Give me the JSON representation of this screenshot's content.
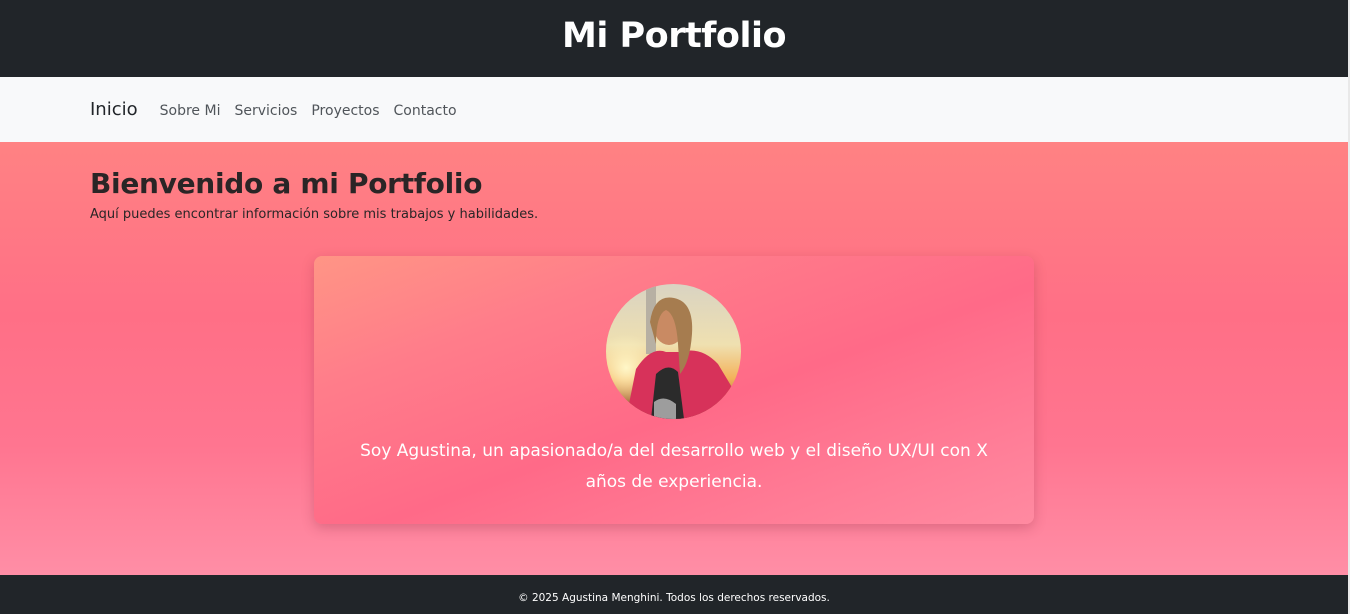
{
  "header": {
    "title": "Mi Portfolio"
  },
  "navbar": {
    "brand": "Inicio",
    "links": [
      "Sobre Mi",
      "Servicios",
      "Proyectos",
      "Contacto"
    ]
  },
  "hero": {
    "title": "Bienvenido a mi Portfolio",
    "subtitle": "Aquí puedes encontrar información sobre mis trabajos y habilidades."
  },
  "about": {
    "text": "Soy Agustina, un apasionado/a del desarrollo web y el diseño UX/UI con X años de experiencia."
  },
  "footer": {
    "text": "© 2025 Agustina Menghini. Todos los derechos reservados."
  },
  "colors": {
    "dark": "#212529",
    "navbar_bg": "#f8f9fa",
    "hero_pink": "#ff6f86",
    "text_white": "#ffffff"
  }
}
